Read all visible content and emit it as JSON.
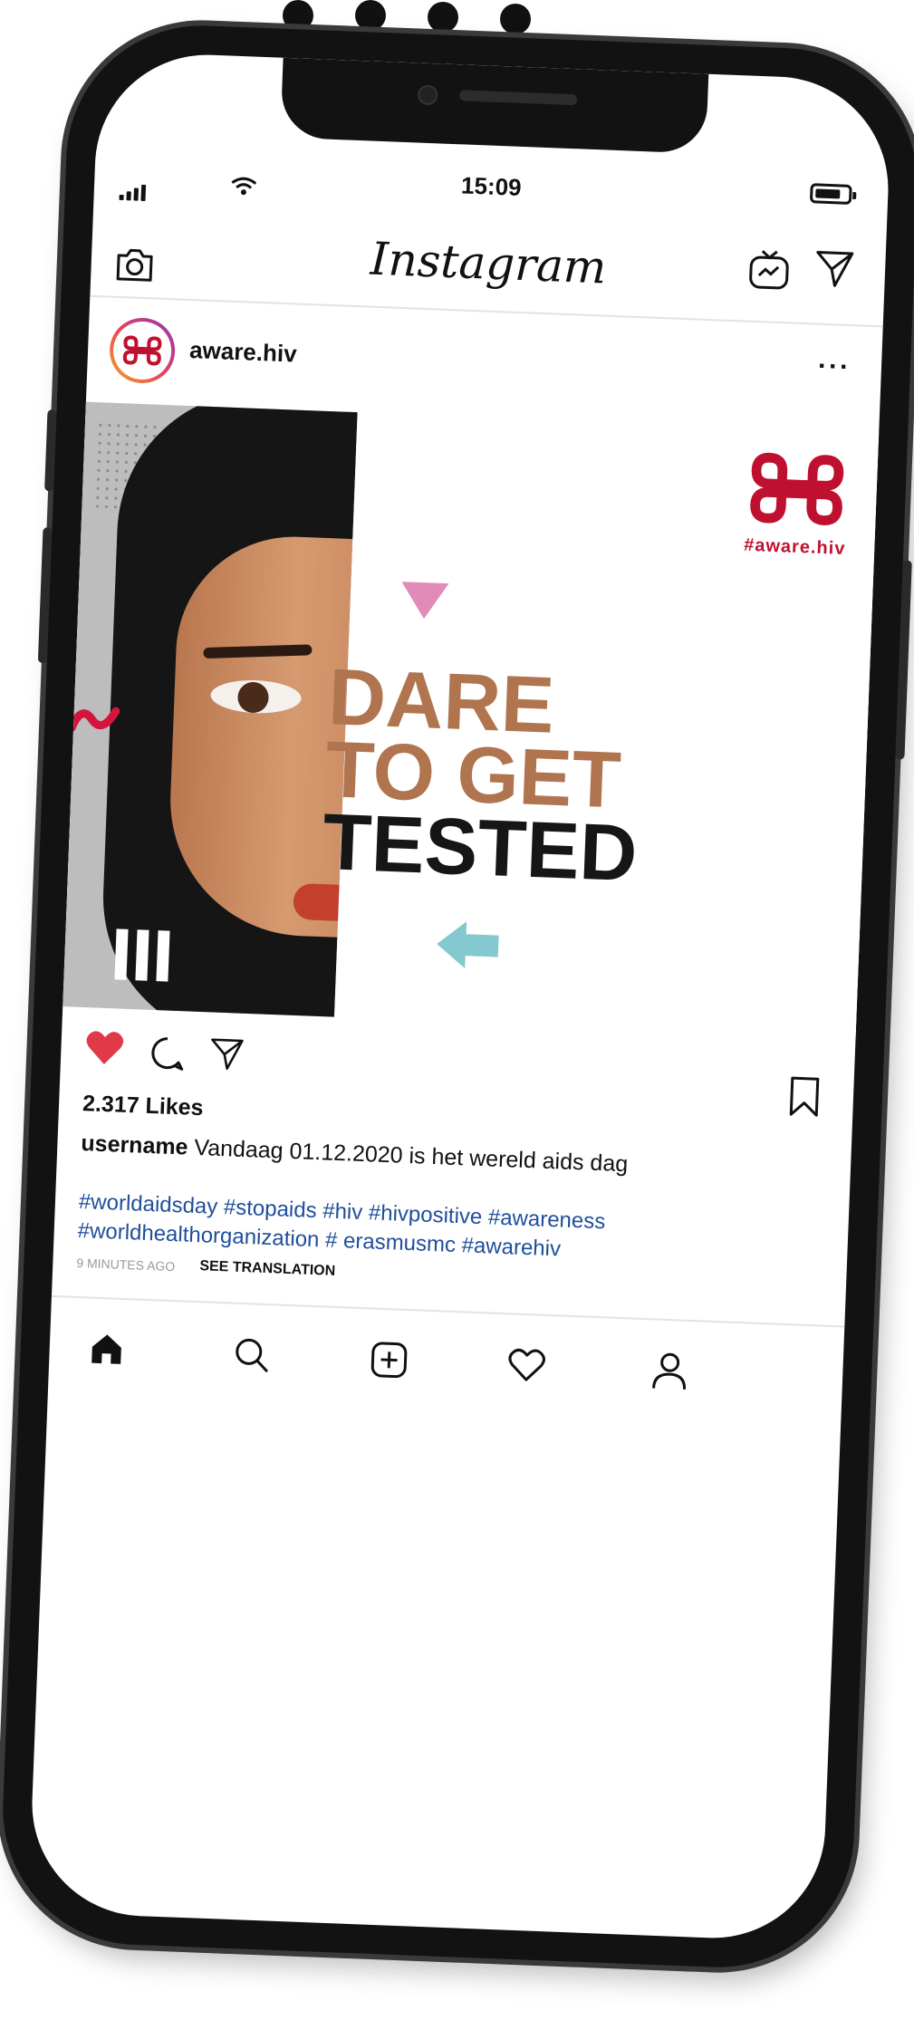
{
  "status_bar": {
    "time": "15:09",
    "battery_level": 0.8
  },
  "header": {
    "logo_text": "Instagram"
  },
  "post": {
    "username": "aware.hiv",
    "more_label": "···",
    "image": {
      "brand_hashtag": "#aware.hiv",
      "headline_lines": [
        "DARE",
        "TO GET",
        "TESTED"
      ]
    },
    "likes": "2.317 Likes",
    "caption": {
      "username": "username",
      "text": "Vandaag 01.12.2020 is het wereld aids dag"
    },
    "hashtags": "#worldaidsday #stopaids #hiv #hivpositive #awareness #worldhealthorganization # erasmusmc #awarehiv",
    "time_ago": "9 MINUTES AGO",
    "see_translation": "SEE TRANSLATION"
  },
  "colors": {
    "brand_red": "#c0102f",
    "like_red": "#e0394a",
    "hashtag_blue": "#1f4e9b",
    "accent_pink": "#e28ab8",
    "accent_teal": "#84c9cf"
  },
  "icons": {
    "top_left": "camera-icon",
    "top_right": [
      "igtv-icon",
      "direct-message-icon"
    ],
    "actions": [
      "heart-icon",
      "comment-icon",
      "share-icon",
      "bookmark-icon"
    ],
    "bottom_nav": [
      "home-icon",
      "search-icon",
      "add-post-icon",
      "activity-heart-icon",
      "profile-icon"
    ]
  }
}
